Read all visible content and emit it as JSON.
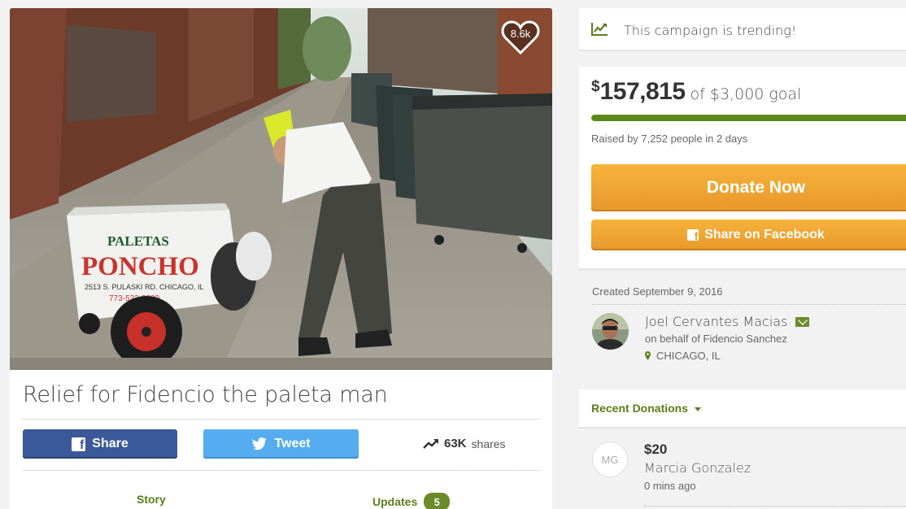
{
  "hero": {
    "heart_count": "8.6k"
  },
  "campaign": {
    "title": "Relief for Fidencio the paleta man"
  },
  "share_bar": {
    "facebook_label": "Share",
    "twitter_label": "Tweet",
    "shares_count": "63K",
    "shares_label": "shares"
  },
  "tabs": [
    {
      "label": "Story"
    },
    {
      "label": "Updates",
      "badge": "5"
    }
  ],
  "trending": {
    "text": "This campaign is trending!"
  },
  "fundraising": {
    "currency_symbol": "$",
    "raised": "157,815",
    "goal_text": "of $3,000 goal",
    "progress_fraction": 1.0,
    "raised_by": "Raised by 7,252 people in 2 days",
    "donate_label": "Donate Now",
    "share_fb_label": "Share on Facebook"
  },
  "organizer": {
    "created": "Created September 9, 2016",
    "name": "Joel Cervantes Macias",
    "on_behalf": "on behalf of Fidencio Sanchez",
    "location": "CHICAGO, IL"
  },
  "recent_donations": {
    "label": "Recent Donations",
    "items": [
      {
        "initials": "MG",
        "amount": "$20",
        "name": "Marcia Gonzalez",
        "time": "0 mins ago"
      }
    ]
  },
  "colors": {
    "accent_green": "#5c7d1a",
    "progress_green": "#5a8a1b",
    "donate_orange": "#f0a534",
    "facebook_blue": "#3b5998",
    "twitter_blue": "#55acee"
  }
}
